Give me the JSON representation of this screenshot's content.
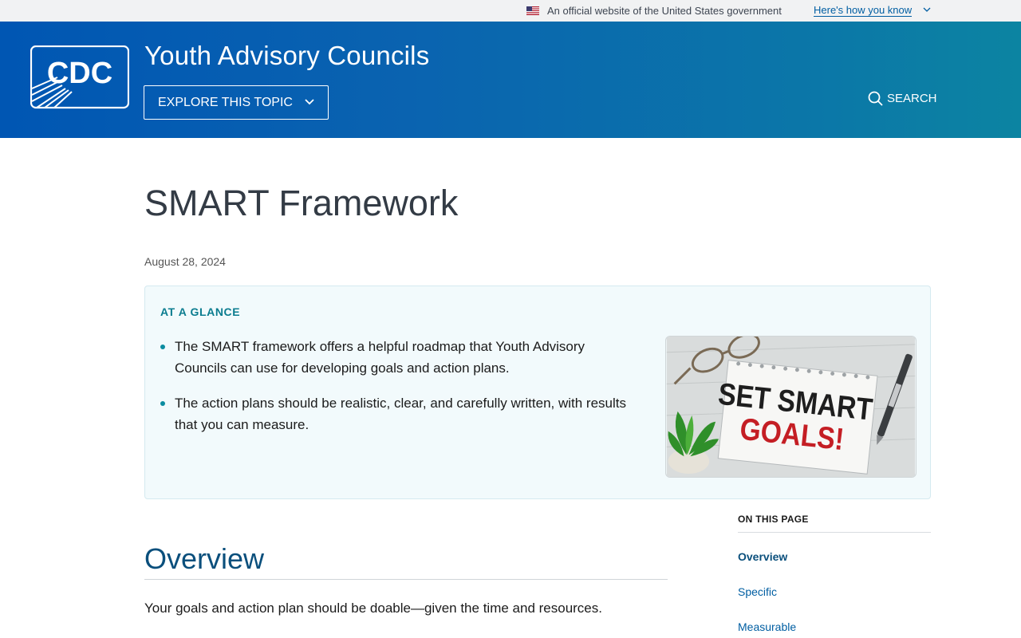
{
  "gov_banner": {
    "official_text": "An official website of the United States government",
    "how_link": "Here's how you know"
  },
  "header": {
    "logo_text": "CDC",
    "site_title": "Youth Advisory Councils",
    "explore_label": "EXPLORE THIS TOPIC",
    "search_label": "SEARCH"
  },
  "main": {
    "title": "SMART Framework",
    "date": "August 28, 2024",
    "at_a_glance": {
      "heading": "AT A GLANCE",
      "bullets": [
        "The SMART framework offers a helpful roadmap that Youth Advisory Councils can use for developing goals and action plans.",
        "The action plans should be realistic, clear, and carefully written, with results that you can measure."
      ],
      "image_text_line1": "SET SMART",
      "image_text_line2": "GOALS!"
    },
    "overview": {
      "heading": "Overview",
      "paragraph": "Your goals and action plan should be doable—given the time and resources."
    }
  },
  "on_this_page": {
    "heading": "ON THIS PAGE",
    "links": [
      "Overview",
      "Specific",
      "Measurable"
    ]
  },
  "colors": {
    "header_gradient_start": "#0056b3",
    "header_gradient_end": "#0c84a2",
    "glance_heading": "#0b7c8f",
    "link": "#005ea2"
  }
}
